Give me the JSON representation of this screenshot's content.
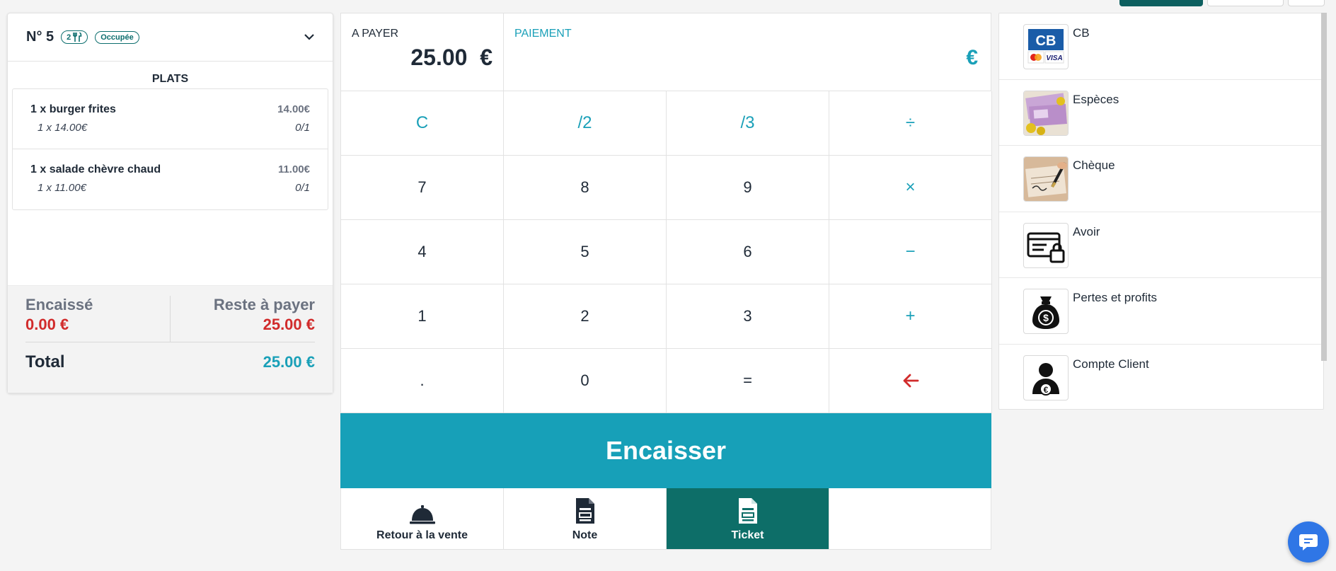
{
  "order": {
    "table_number": "N° 5",
    "guests": "2",
    "status": "Occupée",
    "section_title": "PLATS",
    "items": [
      {
        "name": "1 x burger frites",
        "price": "14.00€",
        "unit": "1 x 14.00€",
        "progress": "0/1"
      },
      {
        "name": "1 x salade chèvre chaud",
        "price": "11.00€",
        "unit": "1 x 11.00€",
        "progress": "0/1"
      }
    ],
    "collected_label": "Encaissé",
    "collected_value": "0.00 €",
    "remaining_label": "Reste à payer",
    "remaining_value": "25.00 €",
    "total_label": "Total",
    "total_value": "25.00 €"
  },
  "payment": {
    "due_label": "A PAYER",
    "due_amount": "25.00  €",
    "payment_label": "PAIEMENT",
    "payment_currency": "€",
    "keys": [
      [
        "C",
        "/2",
        "/3",
        "÷"
      ],
      [
        "7",
        "8",
        "9",
        "×"
      ],
      [
        "4",
        "5",
        "6",
        "−"
      ],
      [
        "1",
        "2",
        "3",
        "+"
      ],
      [
        ".",
        "0",
        "=",
        "←"
      ]
    ],
    "cash_in_label": "Encaisser",
    "actions": {
      "back": "Retour à la vente",
      "note": "Note",
      "ticket": "Ticket"
    }
  },
  "methods": [
    {
      "label": "CB",
      "icon": "credit-card-icon"
    },
    {
      "label": "Espèces",
      "icon": "cash-icon"
    },
    {
      "label": "Chèque",
      "icon": "cheque-icon"
    },
    {
      "label": "Avoir",
      "icon": "voucher-icon"
    },
    {
      "label": "Pertes et profits",
      "icon": "money-bag-icon"
    },
    {
      "label": "Compte Client",
      "icon": "customer-account-icon"
    }
  ],
  "colors": {
    "teal": "#17a0b8",
    "dark_teal": "#0d6e68",
    "red": "#d12b2b"
  }
}
